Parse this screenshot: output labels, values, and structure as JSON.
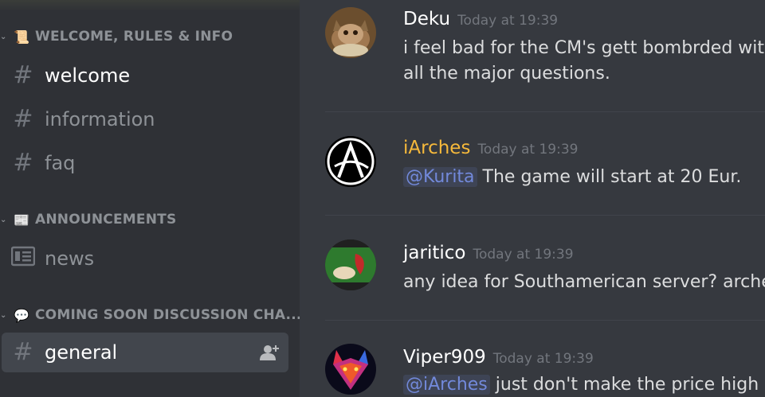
{
  "sidebar": {
    "categories": [
      {
        "emoji": "📜",
        "name": "WELCOME, RULES & INFO"
      },
      {
        "emoji": "📰",
        "name": "ANNOUNCEMENTS"
      },
      {
        "emoji": "💬",
        "name": "COMING SOON DISCUSSION CHA..."
      }
    ],
    "channels": [
      {
        "name": "welcome"
      },
      {
        "name": "information"
      },
      {
        "name": "faq"
      },
      {
        "name": "news"
      },
      {
        "name": "general"
      }
    ],
    "hash_symbol": "#"
  },
  "messages": [
    {
      "author": "Deku",
      "author_color": "#ffffff",
      "timestamp": "Today at 19:39",
      "lines": [
        "i feel bad for the CM's gett bombrded with all",
        "all the major questions."
      ]
    },
    {
      "author": "iArches",
      "author_color": "#f6b93b",
      "timestamp": "Today at 19:39",
      "mention": "@Kurita",
      "text": "The game will start at 20 Eur."
    },
    {
      "author": "jaritico",
      "author_color": "#ffffff",
      "timestamp": "Today at 19:39",
      "text": "any idea for Southamerican server? archer is"
    },
    {
      "author": "Viper909",
      "author_color": "#ffffff",
      "timestamp": "Today at 19:39",
      "mention": "@iArches",
      "text": "just don't make the price high af X"
    }
  ],
  "colors": {
    "sidebar_bg": "#2f3136",
    "chat_bg": "#36393f",
    "active_channel_bg": "#42464d",
    "mention": "#7289da"
  }
}
